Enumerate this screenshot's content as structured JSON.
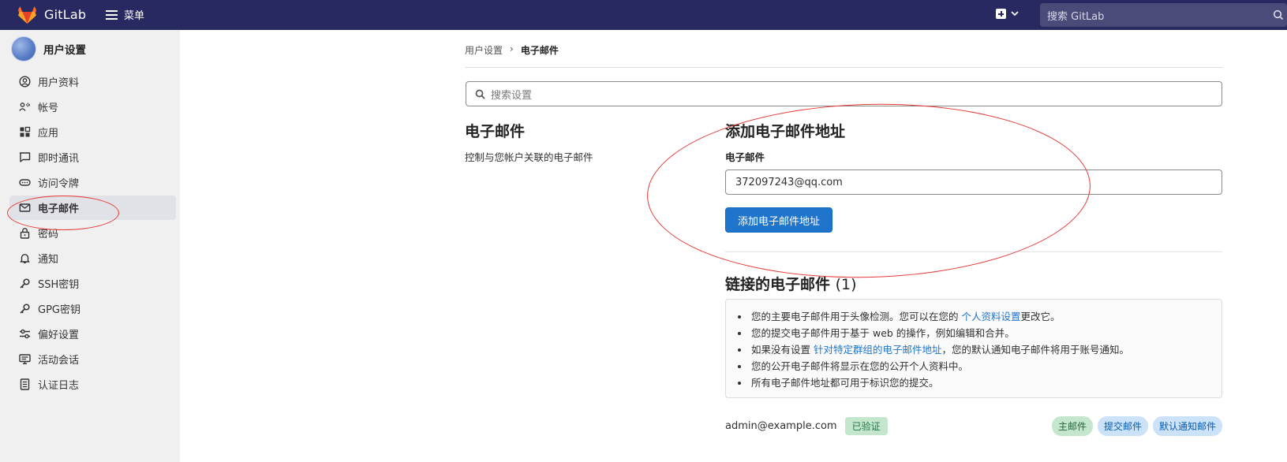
{
  "topbar": {
    "brand": "GitLab",
    "menu_label": "菜单",
    "search_placeholder": "搜索 GitLab"
  },
  "sidebar": {
    "title": "用户设置",
    "items": [
      {
        "label": "用户资料",
        "icon": "user-circle-icon"
      },
      {
        "label": "帐号",
        "icon": "account-gear-icon"
      },
      {
        "label": "应用",
        "icon": "applications-grid-icon"
      },
      {
        "label": "即时通讯",
        "icon": "chat-bubble-icon"
      },
      {
        "label": "访问令牌",
        "icon": "token-icon"
      },
      {
        "label": "电子邮件",
        "icon": "mail-icon",
        "active": true
      },
      {
        "label": "密码",
        "icon": "lock-icon"
      },
      {
        "label": "通知",
        "icon": "bell-icon"
      },
      {
        "label": "SSH密钥",
        "icon": "key-icon"
      },
      {
        "label": "GPG密钥",
        "icon": "key-icon"
      },
      {
        "label": "偏好设置",
        "icon": "preferences-icon"
      },
      {
        "label": "活动会话",
        "icon": "monitor-icon"
      },
      {
        "label": "认证日志",
        "icon": "log-list-icon"
      }
    ]
  },
  "breadcrumb": {
    "parent": "用户设置",
    "separator": "›",
    "current": "电子邮件"
  },
  "settings_search": {
    "placeholder": "搜索设置"
  },
  "email_section": {
    "title": "电子邮件",
    "description": "控制与您帐户关联的电子邮件"
  },
  "add_email": {
    "title": "添加电子邮件地址",
    "field_label": "电子邮件",
    "input_value": "372097243@qq.com",
    "button_label": "添加电子邮件地址"
  },
  "linked_emails": {
    "title": "链接的电子邮件",
    "count": "(1)",
    "info": {
      "line1_pre": "您的主要电子邮件用于头像检测。您可以在您的 ",
      "line1_link": "个人资料设置",
      "line1_post": "更改它。",
      "line2": "您的提交电子邮件用于基于 web 的操作，例如编辑和合并。",
      "line3_pre": "如果没有设置 ",
      "line3_link": "针对特定群组的电子邮件地址",
      "line3_post": "，您的默认通知电子邮件将用于账号通知。",
      "line4": "您的公开电子邮件将显示在您的公开个人资料中。",
      "line5": "所有电子邮件地址都可用于标识您的提交。"
    },
    "emails": [
      {
        "address": "admin@example.com",
        "status": "已验证",
        "tags": [
          "主邮件",
          "提交邮件",
          "默认通知邮件"
        ]
      }
    ]
  },
  "colors": {
    "topbar": "#292961",
    "primary_button": "#1f75cb",
    "link": "#1f75cb",
    "annotation": "#e53935"
  }
}
